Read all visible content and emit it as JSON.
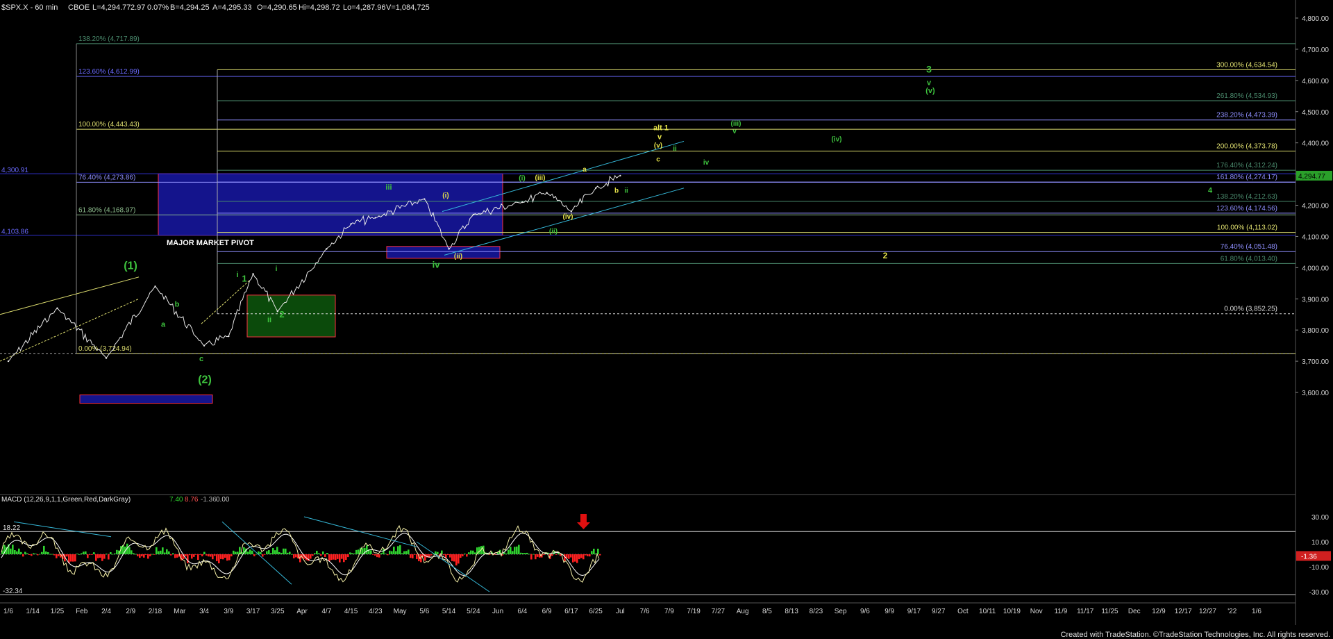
{
  "header": {
    "symbol": "$SPX.X - 60 min",
    "exchange": "CBOE",
    "last": "L=4,294.77",
    "change": "2.97",
    "change_pct": "0.07%",
    "bid": "B=4,294.25",
    "ask": "A=4,295.33",
    "open": "O=4,290.65",
    "high": "Hi=4,298.72",
    "low": "Lo=4,287.96",
    "volume": "V=1,084,725"
  },
  "chart_data": {
    "type": "line",
    "title": "$SPX.X - 60 min",
    "price_axis": {
      "ticks": [
        "4,800.00",
        "4,700.00",
        "4,600.00",
        "4,500.00",
        "4,400.00",
        "4,300.00",
        "4,200.00",
        "4,100.00",
        "4,000.00",
        "3,900.00",
        "3,800.00",
        "3,700.00",
        "3,600.00"
      ],
      "ylim": [
        3560,
        4840
      ],
      "last_price_label": "4,294.77"
    },
    "date_axis": {
      "ticks": [
        "1/6",
        "1/14",
        "1/25",
        "Feb",
        "2/4",
        "2/9",
        "2/18",
        "Mar",
        "3/4",
        "3/9",
        "3/17",
        "3/25",
        "Apr",
        "4/7",
        "4/15",
        "4/23",
        "May",
        "5/6",
        "5/14",
        "5/24",
        "Jun",
        "6/4",
        "6/9",
        "6/17",
        "6/25",
        "Jul",
        "7/6",
        "7/9",
        "7/19",
        "7/27",
        "Aug",
        "8/5",
        "8/13",
        "8/23",
        "Sep",
        "9/6",
        "9/9",
        "9/17",
        "9/27",
        "Oct",
        "10/11",
        "10/19",
        "Nov",
        "11/9",
        "11/17",
        "11/25",
        "Dec",
        "12/9",
        "12/17",
        "12/27",
        "'22",
        "1/6"
      ]
    },
    "price_series": {
      "name": "$SPX.X",
      "x": [
        "1/6",
        "1/25",
        "2/4",
        "2/18",
        "3/4",
        "3/9",
        "3/17",
        "3/25",
        "4/7",
        "4/15",
        "4/23",
        "5/6",
        "5/14",
        "5/24",
        "6/4",
        "6/9",
        "6/17",
        "6/25",
        "Jul"
      ],
      "values": [
        3700,
        3870,
        3710,
        3940,
        3750,
        3780,
        3980,
        3860,
        4060,
        4140,
        4160,
        4220,
        4060,
        4170,
        4210,
        4240,
        4180,
        4255,
        4294.77
      ]
    },
    "fib_levels_left": [
      {
        "label": "138.20% (4,717.89)",
        "value": 4717.89,
        "color": "#4b8c6e"
      },
      {
        "label": "123.60% (4,612.99)",
        "value": 4612.99,
        "color": "#6a6aff"
      },
      {
        "label": "100.00% (4,443.43)",
        "value": 4443.43,
        "color": "#e0e070"
      },
      {
        "label": "76.40% (4,273.86)",
        "value": 4273.86,
        "color": "#8f8fff"
      },
      {
        "label": "61.80% (4,168.97)",
        "value": 4168.97,
        "color": "#8fbf8f"
      },
      {
        "label": "0.00% (3,724.94)",
        "value": 3724.94,
        "color": "#e0e070"
      }
    ],
    "fib_levels_right": [
      {
        "label": "300.00% (4,634.54)",
        "value": 4634.54,
        "color": "#e0e070"
      },
      {
        "label": "261.80% (4,534.93)",
        "value": 4534.93,
        "color": "#4b8c6e"
      },
      {
        "label": "238.20% (4,473.39)",
        "value": 4473.39,
        "color": "#8f8fff"
      },
      {
        "label": "200.00% (4,373.78)",
        "value": 4373.78,
        "color": "#e0e070"
      },
      {
        "label": "176.40% (4,312.24)",
        "value": 4312.24,
        "color": "#4b8c6e"
      },
      {
        "label": "161.80% (4,274.17)",
        "value": 4274.17,
        "color": "#8f8fff"
      },
      {
        "label": "138.20% (4,212.63)",
        "value": 4212.63,
        "color": "#4b8c6e"
      },
      {
        "label": "123.60% (4,174.56)",
        "value": 4174.56,
        "color": "#8f8fff"
      },
      {
        "label": "100.00% (4,113.02)",
        "value": 4113.02,
        "color": "#e0e070"
      },
      {
        "label": "76.40% (4,051.48)",
        "value": 4051.48,
        "color": "#8f8fff"
      },
      {
        "label": "61.80% (4,013.40)",
        "value": 4013.4,
        "color": "#4b8c6e"
      },
      {
        "label": "0.00% (3,852.25)",
        "value": 3852.25,
        "color": "#dddddd"
      }
    ],
    "pivot_labels": [
      "4,300.91",
      "4,103.86"
    ],
    "pivot_box_label": "MAJOR MARKET PIVOT",
    "wave_labels_green": [
      "(1)",
      "(2)",
      "1",
      "2",
      "3",
      "i",
      "ii",
      "iii",
      "iv",
      "v",
      "(v)",
      "(i)",
      "(ii)",
      "(iii)",
      "(iv)",
      "a",
      "b",
      "c",
      "4"
    ],
    "wave_labels_yellow": [
      "alt 1",
      "v",
      "(v)",
      "c",
      "b",
      "ii",
      "2",
      "(i)",
      "(ii)",
      "(iii)",
      "(iv)",
      "a"
    ],
    "macd": {
      "title": "MACD (12,26,9,1,1,Green,Red,DarkGray)",
      "macd_value": "7.40",
      "signal_value": "8.76",
      "hist_value": "-1.36",
      "zero_value": "0.00",
      "upper_line_label": "18.22",
      "lower_line_label": "-32.34",
      "ticks": [
        "30.00",
        "10.00",
        "-10.00",
        "-30.00"
      ],
      "current_label": "-1.36",
      "ylim": [
        -36,
        36
      ]
    }
  },
  "footer": {
    "text": "Created with TradeStation. ©TradeStation Technologies, Inc. All rights reserved."
  },
  "colors": {
    "background": "#000000",
    "price_line": "#e8e8e8",
    "pivot_fill": "#14148c",
    "support_green": "#0b4a0b",
    "macd_pos": "#2fd32f",
    "macd_neg": "#ff2020",
    "macd_line": "#f5f0a8",
    "signal_line": "#ffffff"
  }
}
